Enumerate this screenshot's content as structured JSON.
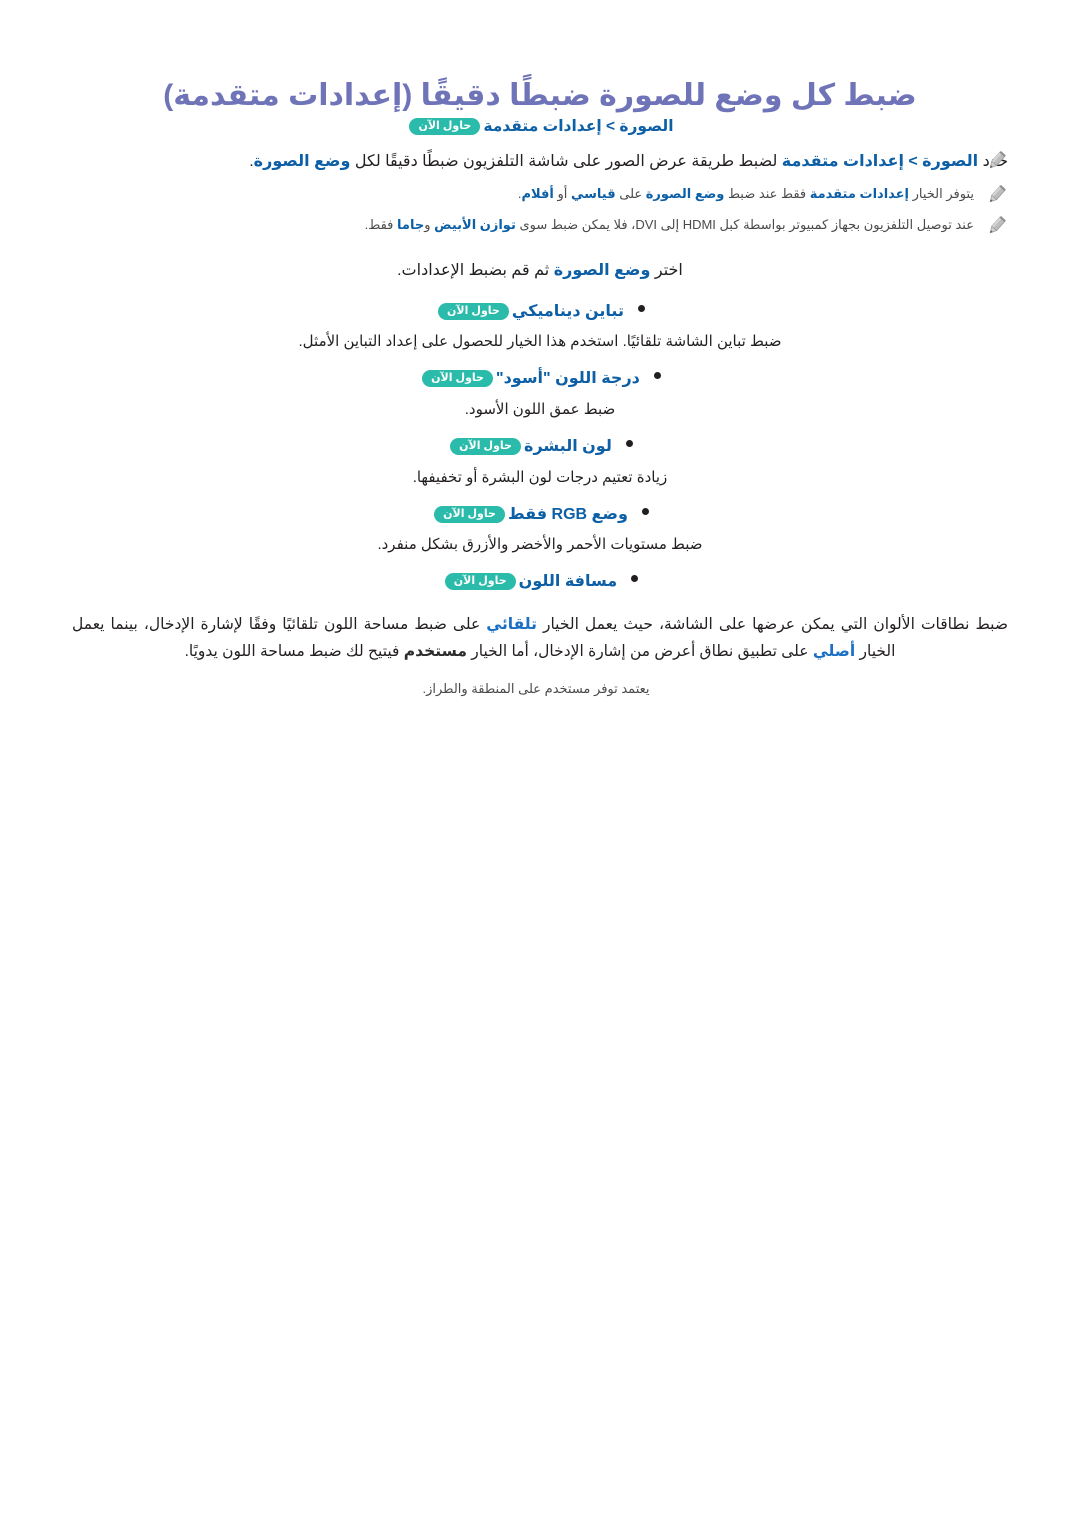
{
  "document": {
    "title": "ضبط كل وضع للصورة ضبطًا دقيقًا (إعدادات متقدمة)",
    "breadcrumb": {
      "path": "الصورة > إعدادات متقدمة",
      "try_now_label": "حاول الآن"
    },
    "lead": {
      "part_1": "حدد",
      "path_bold": "الصورة > إعدادات متقدمة",
      "part_2": "لضبط طريقة عرض الصور على شاشة التلفزيون ضبطًا دقيقًا لكل",
      "bold_tail": "وضع الصورة",
      "period": "."
    },
    "notes_top": [
      {
        "icon": "pencil-icon",
        "segments": [
          {
            "text": "يتوفر الخيار ",
            "style": "plain"
          },
          {
            "text": "إعدادات متقدمة",
            "style": "blue-bold"
          },
          {
            "text": " فقط عند ضبط ",
            "style": "plain"
          },
          {
            "text": "وضع الصورة",
            "style": "blue-bold"
          },
          {
            "text": " على ",
            "style": "plain"
          },
          {
            "text": "قياسي",
            "style": "blue-bold"
          },
          {
            "text": " أو ",
            "style": "plain"
          },
          {
            "text": "أفلام",
            "style": "blue-bold"
          },
          {
            "text": ".",
            "style": "plain"
          }
        ],
        "plain_text": "يتوفر الخيار إعدادات متقدمة فقط عند ضبط وضع الصورة على قياسي أو أفلام."
      },
      {
        "icon": "pencil-icon",
        "plain_text": "عند توصيل التلفزيون بجهاز كمبيوتر بواسطة كبل HDMI إلى DVI، فلا يمكن ضبط سوى توازن الأبيض وجاما فقط."
      }
    ],
    "choose_line": {
      "prefix": "اختر",
      "bold": "وضع الصورة",
      "suffix": "ثم قم بضبط الإعدادات."
    },
    "bullets": [
      {
        "label": "تباين ديناميكي",
        "try_now_label": "حاول الآن",
        "description": "ضبط تباين الشاشة تلقائيًا. استخدم هذا الخيار للحصول على إعداد التباين الأمثل."
      },
      {
        "label": "درجة اللون \"أسود\"",
        "try_now_label": "حاول الآن",
        "description": "ضبط عمق اللون الأسود."
      },
      {
        "label": "لون البشرة",
        "try_now_label": "حاول الآن",
        "description": "زيادة تعتيم درجات لون البشرة أو تخفيفها."
      },
      {
        "label": "وضع RGB فقط",
        "try_now_label": "حاول الآن",
        "description": "ضبط مستويات الأحمر والأخضر والأزرق بشكل منفرد."
      },
      {
        "label": "مسافة اللون",
        "try_now_label": "حاول الآن",
        "description": ""
      }
    ],
    "color_space_paragraph": {
      "line_1_a": "ضبط نطاقات الألوان التي يمكن عرضها على الشاشة، حيث يعمل الخيار",
      "auto_term": "تلقائي",
      "line_1_b": "على ضبط مساحة اللون تلقائيًا وفقًا لإشارة الإدخال، بينما يعمل الخيار",
      "native_term": "أصلي",
      "line_2_a": "على تطبيق نطاق أعرض من إشارة الإدخال، أما الخيار",
      "user_term": "مستخدم",
      "line_2_b": "فيتيح لك ضبط مساحة اللون يدويًا."
    },
    "note_bottom": {
      "icon": "pencil-icon",
      "prefix": "يعتمد توفر",
      "bold_term": "مستخدم",
      "suffix": "على المنطقة والطراز."
    }
  },
  "colors": {
    "title": "#6f73b8",
    "link_blue": "#0d5fa6",
    "badge_teal": "#2bbbaa",
    "body_text": "#231f20",
    "note_text": "#4a4a4a",
    "pencil_gray": "#a8a8a8"
  }
}
